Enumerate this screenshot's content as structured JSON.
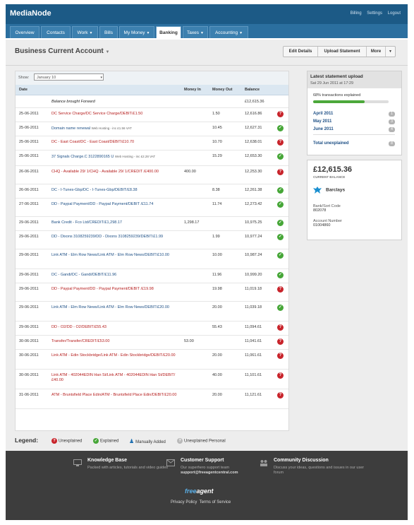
{
  "app": {
    "title": "MediaNode"
  },
  "toplinks": [
    "Billing",
    "Settings",
    "Logout"
  ],
  "nav": [
    {
      "label": "Overview",
      "caret": false,
      "active": false
    },
    {
      "label": "Contacts",
      "caret": false,
      "active": false
    },
    {
      "label": "Work",
      "caret": true,
      "active": false
    },
    {
      "label": "Bills",
      "caret": false,
      "active": false
    },
    {
      "label": "My Money",
      "caret": true,
      "active": false
    },
    {
      "label": "Banking",
      "caret": false,
      "active": true
    },
    {
      "label": "Taxes",
      "caret": true,
      "active": false
    },
    {
      "label": "Accounting",
      "caret": true,
      "active": false
    }
  ],
  "page": {
    "title": "Business Current Account",
    "buttons": {
      "edit": "Edit Details",
      "upload": "Upload Statement",
      "more": "More"
    }
  },
  "filter": {
    "label": "Show:",
    "value": "January 10"
  },
  "table": {
    "headers": {
      "date": "Date",
      "money_in": "Money In",
      "money_out": "Money Out",
      "balance": "Balance"
    },
    "rows": [
      {
        "date": "",
        "desc": "Balance brought Forward",
        "sub": "",
        "in": "",
        "out": "",
        "bal": "£12,615.36",
        "status": "",
        "color": "black"
      },
      {
        "date": "25-06-2011",
        "desc": "DC Service Charge/DC Service Charge/DEBIT/£1.50",
        "sub": "",
        "in": "",
        "out": "1.50",
        "bal": "12,616.86",
        "status": "unexplained",
        "color": "red"
      },
      {
        "date": "25-06-2011",
        "desc": "Domain name renewal",
        "sub": "Web Hosting - inc £1.56 VAT",
        "in": "",
        "out": "10.45",
        "bal": "12,627.31",
        "status": "explained",
        "color": "blue"
      },
      {
        "date": "25-06-2011",
        "desc": "DC - East Coast/DC - East Coast/DEBIT/£10.70",
        "sub": "",
        "in": "",
        "out": "10.70",
        "bal": "12,638.01",
        "status": "unexplained",
        "color": "red"
      },
      {
        "date": "25-06-2011",
        "desc": "37 Signals Charge.C 3122890165 U",
        "sub": "Web Hosting - inc £2.28 VAT",
        "in": "",
        "out": "15.29",
        "bal": "12,653.30",
        "status": "explained",
        "color": "blue"
      },
      {
        "date": "26-06-2011",
        "desc": "CHQ - Available 29/ 1/CHQ - Available 29/ 1/CREDIT /£400.00",
        "sub": "",
        "in": "400.00",
        "out": "",
        "bal": "12,253.30",
        "status": "unexplained",
        "color": "red"
      },
      {
        "date": "26-06-2011",
        "desc": "DC - I-Tunes-Gbp/DC - I-Tunes-Gbp/DEBIT/£8.38",
        "sub": "",
        "in": "",
        "out": "8.38",
        "bal": "12,261.38",
        "status": "explained",
        "color": "blue"
      },
      {
        "date": "27-06-2011",
        "desc": "DD - Paypal Payment/DD - Paypal Payment/DEBIT /£11.74",
        "sub": "",
        "in": "",
        "out": "11.74",
        "bal": "12,273.42",
        "status": "explained",
        "color": "blue"
      },
      {
        "date": "29-06-2011",
        "desc": "Bank Credit - Fco Ltd/CREDIT/£1,298.17",
        "sub": "",
        "in": "1,298.17",
        "out": "",
        "bal": "10,975.25",
        "status": "explained",
        "color": "blue"
      },
      {
        "date": "29-06-2011",
        "desc": "DD - Dixons 3108259239/DD - Dixons 3108259239/DEBIT/£1.99",
        "sub": "",
        "in": "",
        "out": "1.99",
        "bal": "10,977.24",
        "status": "explained",
        "color": "blue"
      },
      {
        "date": "29-06-2011",
        "desc": "Link ATM - Elm Row News/Link ATM - Elm Row News/DEBIT/£10.00",
        "sub": "",
        "in": "",
        "out": "10.00",
        "bal": "10,987.24",
        "status": "explained",
        "color": "blue"
      },
      {
        "date": "29-06-2011",
        "desc": "DC - Gandi/DC - Gandi/DEBIT/£11.96",
        "sub": "",
        "in": "",
        "out": "11.96",
        "bal": "10,999.20",
        "status": "explained",
        "color": "blue"
      },
      {
        "date": "29-06-2011",
        "desc": "DD - Paypal Payment/DD - Paypal Payment/DEBIT /£19.98",
        "sub": "",
        "in": "",
        "out": "19.98",
        "bal": "11,019.18",
        "status": "unexplained",
        "color": "red"
      },
      {
        "date": "29-06-2011",
        "desc": "Link ATM - Elm Row News/Link ATM - Elm Row News/DEBIT/£20.00",
        "sub": "",
        "in": "",
        "out": "20.00",
        "bal": "11,039.18",
        "status": "explained",
        "color": "blue"
      },
      {
        "date": "29-06-2011",
        "desc": "DD - O2/DD - O2/DEBIT/£55.43",
        "sub": "",
        "in": "",
        "out": "55.43",
        "bal": "11,094.61",
        "status": "unexplained",
        "color": "red"
      },
      {
        "date": "30-06-2011",
        "desc": "Transfer/Transfer/CREDIT/£53.00",
        "sub": "",
        "in": "53.00",
        "out": "",
        "bal": "11,041.61",
        "status": "unexplained",
        "color": "red"
      },
      {
        "date": "30-06-2011",
        "desc": "Link ATM - Edin Stockbridge/Link ATM - Edin Stockbridge/DEBIT/£20.00",
        "sub": "",
        "in": "",
        "out": "20.00",
        "bal": "11,061.61",
        "status": "unexplained",
        "color": "red"
      },
      {
        "date": "30-06-2011",
        "desc": "Link ATM - 402044EDIN Han St/Link ATM - 402044EDIN Han St/DEBIT/£40.00",
        "sub": "",
        "in": "",
        "out": "40.00",
        "bal": "11,101.61",
        "status": "unexplained",
        "color": "red"
      },
      {
        "date": "31-06-2011",
        "desc": "ATM - Bruntsfield Place Edin/ATM - Bruntsfield Place Edin/DEBIT/£20.00",
        "sub": "",
        "in": "",
        "out": "20.00",
        "bal": "11,121.61",
        "status": "unexplained",
        "color": "red"
      }
    ]
  },
  "legend": {
    "title": "Legend:",
    "unexplained": "Unexplained",
    "explained": "Explained",
    "manual": "Manually Added",
    "personal": "Unexplained Personal"
  },
  "statement": {
    "title": "Latest statement upload",
    "date": "Sat 29 Jun 2011 at 17:29",
    "pct_text": "68% transactions explained",
    "pct": 68,
    "months": [
      {
        "label": "April 2011",
        "count": "1"
      },
      {
        "label": "May 2011",
        "count": "3"
      },
      {
        "label": "June 2011",
        "count": "4"
      }
    ],
    "total_label": "Total unexplained",
    "total_count": "8"
  },
  "balance": {
    "amount": "£12,615.36",
    "label": "CURRENT BALANCE",
    "bank": "Barclays",
    "sort_label": "Bank/Sort Code",
    "sort_value": "802078",
    "acct_label": "Account Number",
    "acct_value": "01004860"
  },
  "footer": {
    "kb_title": "Knowledge Base",
    "kb_text": "Packed with articles, tutorials and video guides",
    "cs_title": "Customer Support",
    "cs_text": "Our superhero support team",
    "cs_email": "support@freeagentcentral.com",
    "cd_title": "Community Discussion",
    "cd_text": "Discuss your ideas, questions and issues in our user forum",
    "logo_a": "free",
    "logo_b": "agent",
    "privacy": "Privacy Policy",
    "terms": "Terms of Service"
  },
  "colors": {
    "topbar": "#1c5a86",
    "unexplained": "#c8242b",
    "explained": "#46a637",
    "link": "#1d4f85"
  }
}
